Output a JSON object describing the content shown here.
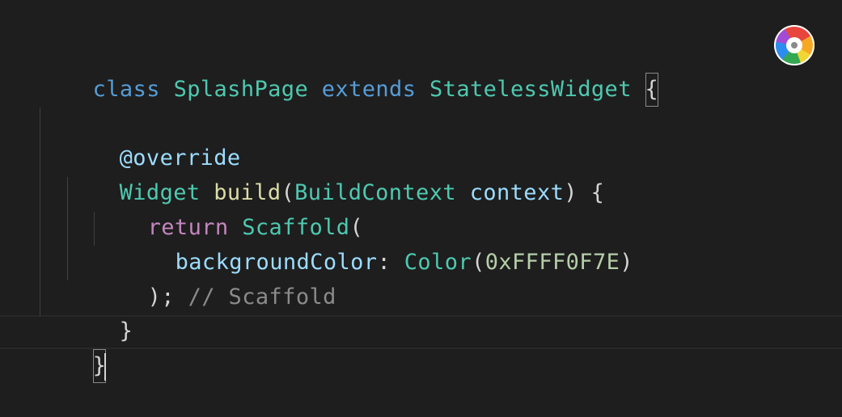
{
  "code": {
    "line1": {
      "kw_class": "class",
      "class_name": "SplashPage",
      "kw_extends": "extends",
      "parent": "StatelessWidget",
      "brace": "{"
    },
    "line3": {
      "annotation": "@override"
    },
    "line4": {
      "type": "Widget",
      "method": "build",
      "paren_open": "(",
      "param_type": "BuildContext",
      "param_name": "context",
      "rest": ") {"
    },
    "line5": {
      "kw_return": "return",
      "call": "Scaffold",
      "paren": "("
    },
    "line6": {
      "prop": "backgroundColor",
      "colon": ":",
      "type": "Color",
      "paren_open": "(",
      "value": "0xFFFF0F7E",
      "paren_close": ")"
    },
    "line7": {
      "close": ");",
      "comment": "// Scaffold"
    },
    "line8": {
      "brace": "}"
    },
    "line9": {
      "brace": "}"
    }
  },
  "colors": {
    "keyword": "#569cd6",
    "type": "#4ec9b0",
    "function": "#dcdcaa",
    "variable": "#9cdcfe",
    "control": "#c586c0",
    "number": "#b5cea8",
    "comment": "#6a9955",
    "punctuation": "#d4d4d4",
    "background": "#1e1e1e"
  },
  "logo": {
    "icon": "color-wheel-icon"
  }
}
